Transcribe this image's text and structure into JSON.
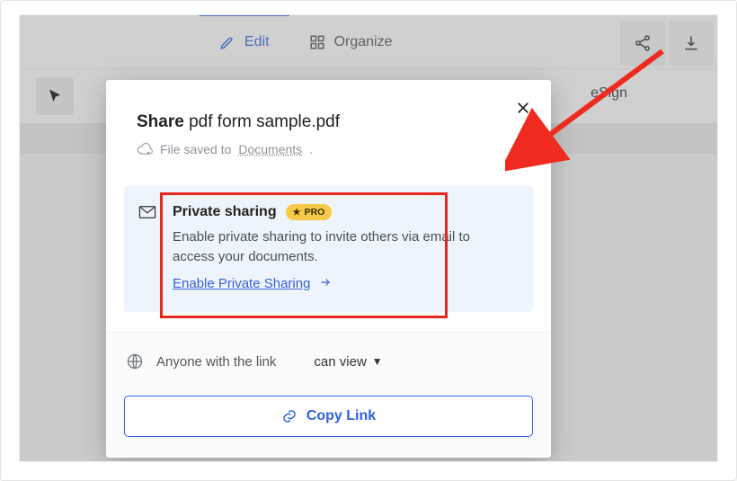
{
  "toolbar": {
    "edit_label": "Edit",
    "organize_label": "Organize",
    "esign_label": "eSign"
  },
  "modal": {
    "title_prefix": "Share",
    "filename": "pdf form sample.pdf",
    "saved_prefix": "File saved to ",
    "saved_location": "Documents",
    "private": {
      "heading": "Private sharing",
      "badge": "PRO",
      "description": "Enable private sharing to invite others via email to access your documents.",
      "enable_link": "Enable Private Sharing"
    },
    "permission": {
      "scope_label": "Anyone with the link",
      "access_label": "can view"
    },
    "copy_button": "Copy Link"
  }
}
